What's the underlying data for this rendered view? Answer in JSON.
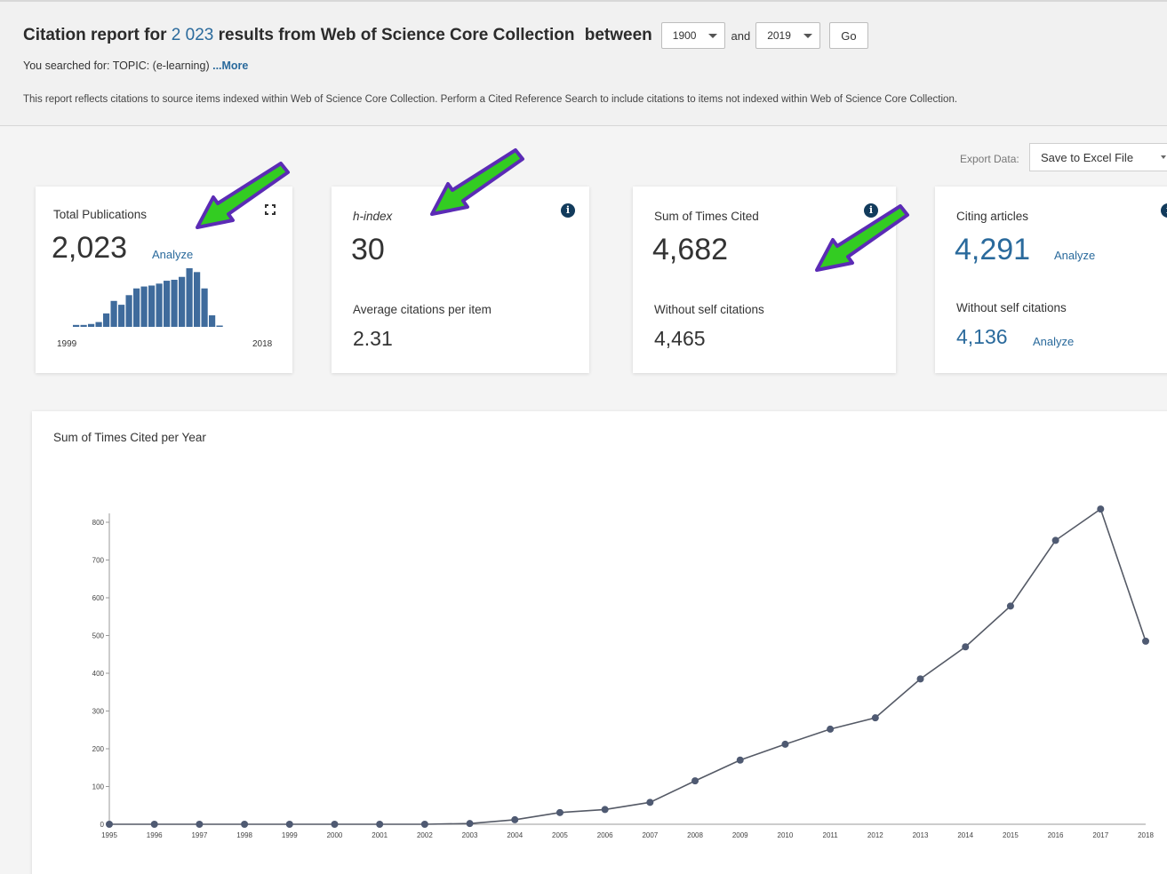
{
  "header": {
    "title_prefix": "Citation report for",
    "result_count": "2 023",
    "title_suffix": "results from Web of Science Core Collection",
    "between_label": "between",
    "from_year": "1900",
    "and_label": "and",
    "to_year": "2019",
    "go_label": "Go",
    "searched_text": "You searched for: TOPIC: (e-learning)",
    "more_label": "...More",
    "report_note": "This report reflects citations to source items indexed within Web of Science Core Collection. Perform a Cited Reference Search to include citations to items not indexed within Web of Science Core Collection."
  },
  "export": {
    "label": "Export Data:",
    "selected": "Save to Excel File"
  },
  "cards": {
    "total_publications": {
      "label": "Total Publications",
      "value": "2,023",
      "analyze": "Analyze",
      "year_start": "1999",
      "year_end": "2018"
    },
    "h_index": {
      "label": "h-index",
      "value": "30",
      "sub_label": "Average citations per item",
      "sub_value": "2.31"
    },
    "sum_times_cited": {
      "label": "Sum of Times Cited",
      "value": "4,682",
      "sub_label": "Without self citations",
      "sub_value": "4,465"
    },
    "citing_articles": {
      "label": "Citing articles",
      "value": "4,291",
      "analyze": "Analyze",
      "sub_label": "Without self citations",
      "sub_value": "4,136",
      "sub_analyze": "Analyze"
    }
  },
  "colors": {
    "accent": "#2a6a9c",
    "bar": "#3f6b9c",
    "line": "#555a66",
    "point": "#4f5a72",
    "arrow_fill": "#33cc22",
    "arrow_stroke": "#5b2bb5"
  },
  "chart_panel": {
    "title": "Sum of Times Cited per Year"
  },
  "chart_data": [
    {
      "type": "bar",
      "x": [
        1999,
        2000,
        2001,
        2002,
        2003,
        2004,
        2005,
        2006,
        2007,
        2008,
        2009,
        2010,
        2011,
        2012,
        2013,
        2014,
        2015,
        2016,
        2017,
        2018
      ],
      "values": [
        2,
        2,
        3,
        5,
        14,
        27,
        23,
        33,
        40,
        42,
        43,
        45,
        48,
        49,
        52,
        61,
        57,
        40,
        12,
        0
      ],
      "xlabel_start": "1999",
      "xlabel_end": "2018"
    },
    {
      "type": "line",
      "x": [
        "1995",
        "1996",
        "1997",
        "1998",
        "1999",
        "2000",
        "2001",
        "2002",
        "2003",
        "2004",
        "2005",
        "2006",
        "2007",
        "2008",
        "2009",
        "2010",
        "2011",
        "2012",
        "2013",
        "2014",
        "2015",
        "2016",
        "2017",
        "2018"
      ],
      "values": [
        0,
        0,
        0,
        0,
        0,
        0,
        0,
        0,
        2,
        12,
        31,
        39,
        58,
        115,
        170,
        212,
        252,
        282,
        385,
        470,
        578,
        752,
        835,
        485
      ],
      "ylim": [
        0,
        800
      ],
      "yticks": [
        0,
        100,
        200,
        300,
        400,
        500,
        600,
        700,
        800
      ],
      "title": "Sum of Times Cited per Year"
    }
  ]
}
